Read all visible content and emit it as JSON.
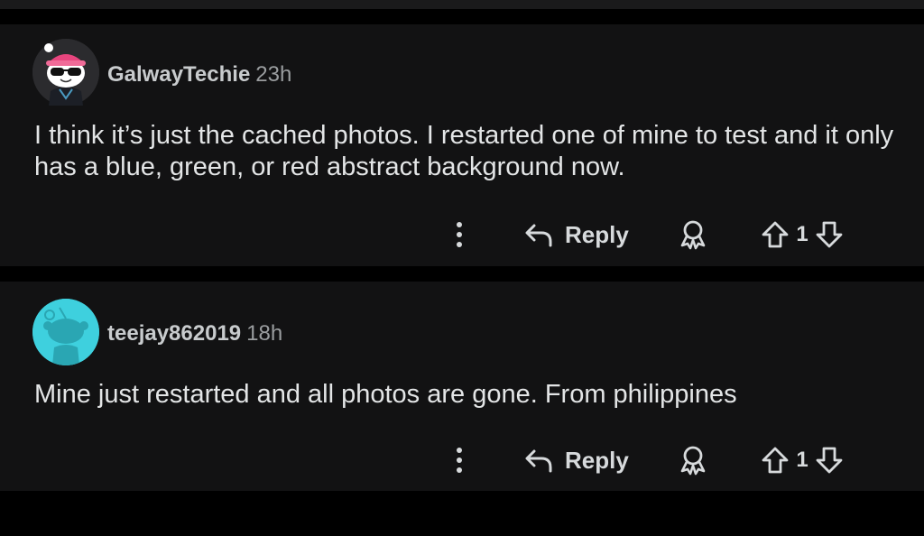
{
  "comments": [
    {
      "username": "GalwayTechie",
      "timestamp": "23h",
      "body": "I think it’s just the cached photos. I restarted one of mine to test and it only has a blue, green, or red abstract background now.",
      "actions": {
        "reply_label": "Reply",
        "score": "1"
      },
      "avatar_icon": "snoo-panda-avatar-icon"
    },
    {
      "username": "teejay862019",
      "timestamp": "18h",
      "body": "Mine just restarted and all photos are gone. From philippines",
      "actions": {
        "reply_label": "Reply",
        "score": "1"
      },
      "avatar_icon": "default-snoo-avatar-icon"
    }
  ],
  "colors": {
    "background": "#000000",
    "card": "#121213",
    "text": "#d7dadc",
    "avatar_default_bg": "#3ed0de"
  }
}
